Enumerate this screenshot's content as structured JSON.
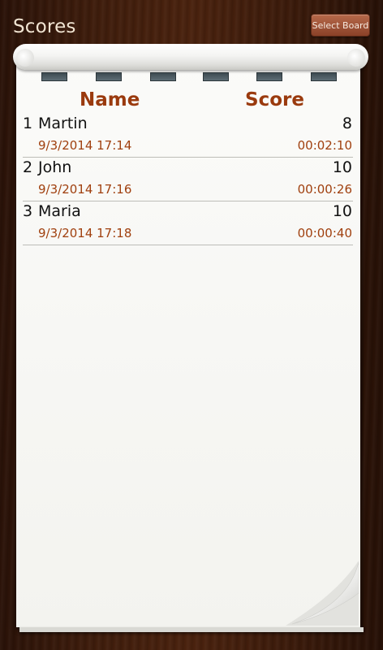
{
  "app": {
    "title": "Scores",
    "select_board_label": "Select Board"
  },
  "table": {
    "headers": {
      "name": "Name",
      "score": "Score"
    },
    "rows": [
      {
        "rank": "1",
        "name": "Martin",
        "score": "8",
        "date": "9/3/2014 17:14",
        "time": "00:02:10"
      },
      {
        "rank": "2",
        "name": "John",
        "score": "10",
        "date": "9/3/2014 17:16",
        "time": "00:00:26"
      },
      {
        "rank": "3",
        "name": "Maria",
        "score": "10",
        "date": "9/3/2014 17:18",
        "time": "00:00:40"
      }
    ]
  },
  "colors": {
    "header_text": "#9a3a0e",
    "meta_text": "#a0400f",
    "button_bg": "#a0543a",
    "background_wood": "#3f1d0c"
  }
}
